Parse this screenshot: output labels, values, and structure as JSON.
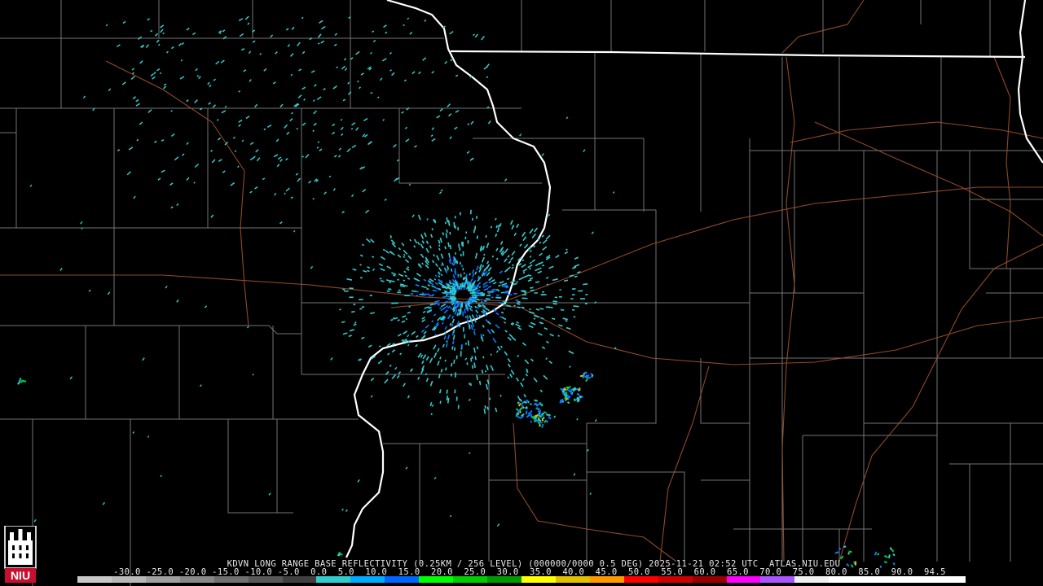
{
  "product": {
    "caption": "KDVN LONG RANGE BASE REFLECTIVITY (0.25KM / 256 LEVEL) (000000/0000 0.5 DEG) 2025-11-21 02:52 UTC  ATLAS.NIU.EDU",
    "scale_labels": "-30.0 -25.0 -20.0 -15.0 -10.0 -5.0  0.0  5.0  10.0  15.0  20.0  25.0  30.0  35.0  40.0  45.0  50.0  55.0  60.0  65.0  70.0  75.0  80.0  85.0  90.0  94.5"
  },
  "colorbar": {
    "colors": [
      "#c8c8c8",
      "#b8b8b8",
      "#a0a0a0",
      "#888888",
      "#707070",
      "#585858",
      "#404040",
      "#33cccc",
      "#00aaff",
      "#0066ff",
      "#00ff00",
      "#00cc00",
      "#009900",
      "#ffff00",
      "#e0c000",
      "#ff9900",
      "#ff0000",
      "#cc0000",
      "#990000",
      "#ff00ff",
      "#aa55ff",
      "#f0f0f0",
      "#ffffff",
      "#ffffff",
      "#ffffff",
      "#ffffff"
    ]
  },
  "logo": {
    "text": "NIU",
    "color": "#c8102e"
  },
  "colors": {
    "background": "#000000",
    "state_border": "#ffffff",
    "county_line": "#8a8a8a",
    "highway": "#a0522d",
    "echo_light": "#33cccc",
    "echo_mid": "#0a7aff",
    "echo_heavy": "#00cc44"
  }
}
